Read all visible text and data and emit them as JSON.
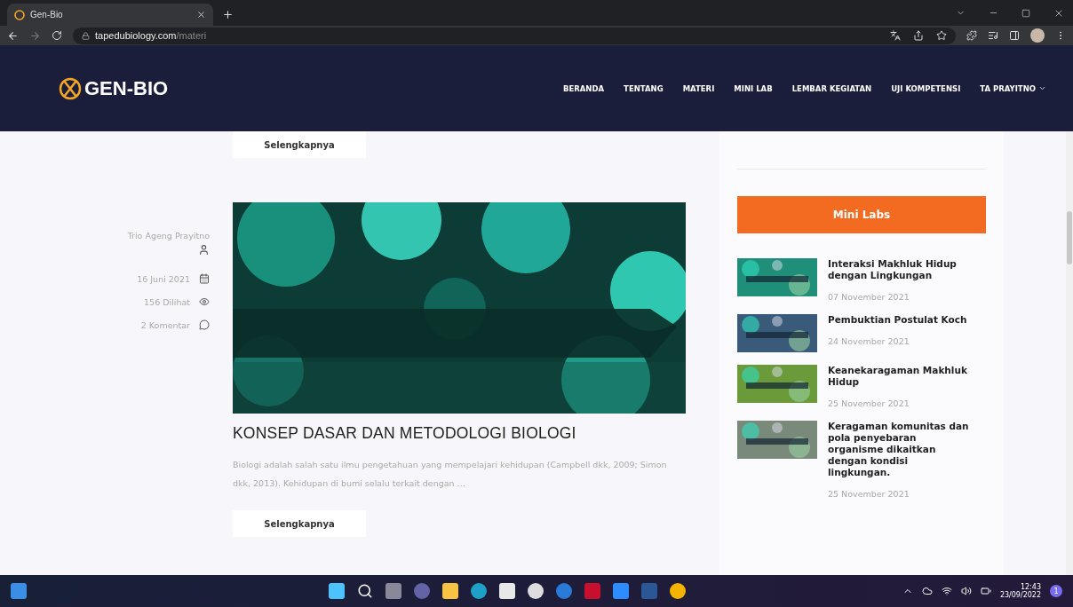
{
  "browser": {
    "tab_title": "Gen-Bio",
    "url_host": "tapedubiology.com",
    "url_path": "/materi"
  },
  "site": {
    "logo": "GEN-BIO",
    "nav": [
      {
        "label": "BERANDA",
        "dropdown": false
      },
      {
        "label": "TENTANG",
        "dropdown": false
      },
      {
        "label": "MATERI",
        "dropdown": false
      },
      {
        "label": "MINI LAB",
        "dropdown": false
      },
      {
        "label": "LEMBAR KEGIATAN",
        "dropdown": false
      },
      {
        "label": "UJI KOMPETENSI",
        "dropdown": false
      },
      {
        "label": "TA PRAYITNO",
        "dropdown": true
      }
    ]
  },
  "top_button": "Selengkapnya",
  "post": {
    "author": "Trio Ageng Prayitno",
    "date": "16 Juni 2021",
    "views": "156 Dilihat",
    "comments": "2 Komentar",
    "title": "KONSEP DASAR DAN METODOLOGI BIOLOGI",
    "excerpt": "Biologi adalah salah satu ilmu pengetahuan yang mempelajari kehidupan (Campbell dkk, 2009; Simon dkk, 2013). Kehidupan di bumi selalu terkait dengan …",
    "button": "Selengkapnya"
  },
  "sidebar": {
    "heading": "Mini Labs",
    "items": [
      {
        "title": "Interaksi Makhluk Hidup dengan Lingkungan",
        "date": "07 November 2021",
        "color": "#1f8f7a"
      },
      {
        "title": "Pembuktian Postulat Koch",
        "date": "24 November 2021",
        "color": "#3a5a7a"
      },
      {
        "title": "Keanekaragaman Makhluk Hidup",
        "date": "25 November 2021",
        "color": "#6a9a3a"
      },
      {
        "title": "Keragaman komunitas dan pola penyebaran organisme dikaitkan dengan kondisi lingkungan.",
        "date": "25 November 2021",
        "color": "#7a8a7a"
      }
    ]
  },
  "taskbar": {
    "time": "12:43",
    "date": "23/09/2022",
    "notification_count": "1"
  }
}
